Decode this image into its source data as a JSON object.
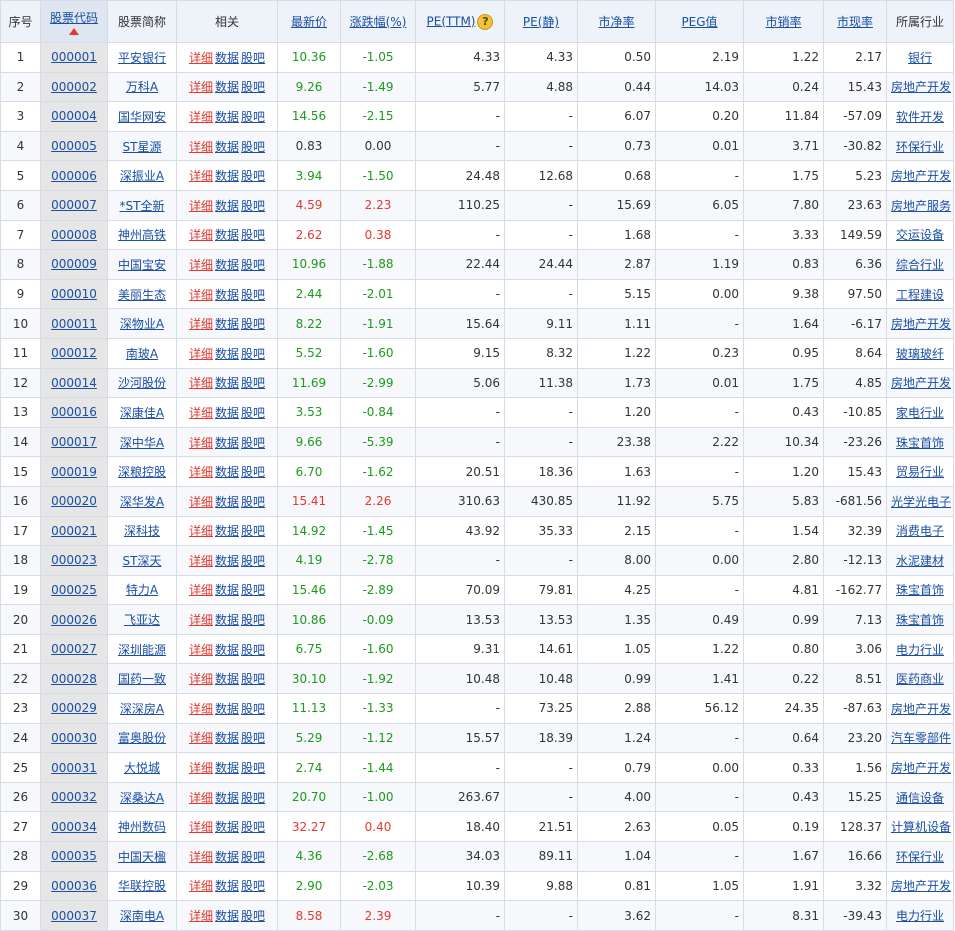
{
  "headers": {
    "idx": "序号",
    "code": "股票代码",
    "name": "股票简称",
    "related": "相关",
    "price": "最新价",
    "change": "涨跌幅(%)",
    "pe_ttm": "PE(TTM)",
    "pe_static": "PE(静)",
    "pb": "市净率",
    "peg": "PEG值",
    "ps": "市销率",
    "pcf": "市现率",
    "industry": "所属行业"
  },
  "related_links": {
    "detail": "详细",
    "data": "数据",
    "bar": "股吧"
  },
  "help_icon_glyph": "?",
  "colors": {
    "up": "#e4392f",
    "down": "#1c9a1c",
    "link": "#1a4fa3"
  },
  "rows": [
    {
      "idx": "1",
      "code": "000001",
      "name": "平安银行",
      "price": "10.36",
      "change": "-1.05",
      "pe_ttm": "4.33",
      "pe_static": "4.33",
      "pb": "0.50",
      "peg": "2.19",
      "ps": "1.22",
      "pcf": "2.17",
      "industry": "银行",
      "dir": "down"
    },
    {
      "idx": "2",
      "code": "000002",
      "name": "万科A",
      "price": "9.26",
      "change": "-1.49",
      "pe_ttm": "5.77",
      "pe_static": "4.88",
      "pb": "0.44",
      "peg": "14.03",
      "ps": "0.24",
      "pcf": "15.43",
      "industry": "房地产开发",
      "dir": "down"
    },
    {
      "idx": "3",
      "code": "000004",
      "name": "国华网安",
      "price": "14.56",
      "change": "-2.15",
      "pe_ttm": "-",
      "pe_static": "-",
      "pb": "6.07",
      "peg": "0.20",
      "ps": "11.84",
      "pcf": "-57.09",
      "industry": "软件开发",
      "dir": "down"
    },
    {
      "idx": "4",
      "code": "000005",
      "name": "ST星源",
      "price": "0.83",
      "change": "0.00",
      "pe_ttm": "-",
      "pe_static": "-",
      "pb": "0.73",
      "peg": "0.01",
      "ps": "3.71",
      "pcf": "-30.82",
      "industry": "环保行业",
      "dir": "flat"
    },
    {
      "idx": "5",
      "code": "000006",
      "name": "深振业A",
      "price": "3.94",
      "change": "-1.50",
      "pe_ttm": "24.48",
      "pe_static": "12.68",
      "pb": "0.68",
      "peg": "-",
      "ps": "1.75",
      "pcf": "5.23",
      "industry": "房地产开发",
      "dir": "down"
    },
    {
      "idx": "6",
      "code": "000007",
      "name": "*ST全新",
      "price": "4.59",
      "change": "2.23",
      "pe_ttm": "110.25",
      "pe_static": "-",
      "pb": "15.69",
      "peg": "6.05",
      "ps": "7.80",
      "pcf": "23.63",
      "industry": "房地产服务",
      "dir": "up"
    },
    {
      "idx": "7",
      "code": "000008",
      "name": "神州高铁",
      "price": "2.62",
      "change": "0.38",
      "pe_ttm": "-",
      "pe_static": "-",
      "pb": "1.68",
      "peg": "-",
      "ps": "3.33",
      "pcf": "149.59",
      "industry": "交运设备",
      "dir": "up"
    },
    {
      "idx": "8",
      "code": "000009",
      "name": "中国宝安",
      "price": "10.96",
      "change": "-1.88",
      "pe_ttm": "22.44",
      "pe_static": "24.44",
      "pb": "2.87",
      "peg": "1.19",
      "ps": "0.83",
      "pcf": "6.36",
      "industry": "综合行业",
      "dir": "down"
    },
    {
      "idx": "9",
      "code": "000010",
      "name": "美丽生态",
      "price": "2.44",
      "change": "-2.01",
      "pe_ttm": "-",
      "pe_static": "-",
      "pb": "5.15",
      "peg": "0.00",
      "ps": "9.38",
      "pcf": "97.50",
      "industry": "工程建设",
      "dir": "down"
    },
    {
      "idx": "10",
      "code": "000011",
      "name": "深物业A",
      "price": "8.22",
      "change": "-1.91",
      "pe_ttm": "15.64",
      "pe_static": "9.11",
      "pb": "1.11",
      "peg": "-",
      "ps": "1.64",
      "pcf": "-6.17",
      "industry": "房地产开发",
      "dir": "down"
    },
    {
      "idx": "11",
      "code": "000012",
      "name": "南玻A",
      "price": "5.52",
      "change": "-1.60",
      "pe_ttm": "9.15",
      "pe_static": "8.32",
      "pb": "1.22",
      "peg": "0.23",
      "ps": "0.95",
      "pcf": "8.64",
      "industry": "玻璃玻纤",
      "dir": "down"
    },
    {
      "idx": "12",
      "code": "000014",
      "name": "沙河股份",
      "price": "11.69",
      "change": "-2.99",
      "pe_ttm": "5.06",
      "pe_static": "11.38",
      "pb": "1.73",
      "peg": "0.01",
      "ps": "1.75",
      "pcf": "4.85",
      "industry": "房地产开发",
      "dir": "down"
    },
    {
      "idx": "13",
      "code": "000016",
      "name": "深康佳A",
      "price": "3.53",
      "change": "-0.84",
      "pe_ttm": "-",
      "pe_static": "-",
      "pb": "1.20",
      "peg": "-",
      "ps": "0.43",
      "pcf": "-10.85",
      "industry": "家电行业",
      "dir": "down"
    },
    {
      "idx": "14",
      "code": "000017",
      "name": "深中华A",
      "price": "9.66",
      "change": "-5.39",
      "pe_ttm": "-",
      "pe_static": "-",
      "pb": "23.38",
      "peg": "2.22",
      "ps": "10.34",
      "pcf": "-23.26",
      "industry": "珠宝首饰",
      "dir": "down"
    },
    {
      "idx": "15",
      "code": "000019",
      "name": "深粮控股",
      "price": "6.70",
      "change": "-1.62",
      "pe_ttm": "20.51",
      "pe_static": "18.36",
      "pb": "1.63",
      "peg": "-",
      "ps": "1.20",
      "pcf": "15.43",
      "industry": "贸易行业",
      "dir": "down"
    },
    {
      "idx": "16",
      "code": "000020",
      "name": "深华发A",
      "price": "15.41",
      "change": "2.26",
      "pe_ttm": "310.63",
      "pe_static": "430.85",
      "pb": "11.92",
      "peg": "5.75",
      "ps": "5.83",
      "pcf": "-681.56",
      "industry": "光学光电子",
      "dir": "up"
    },
    {
      "idx": "17",
      "code": "000021",
      "name": "深科技",
      "price": "14.92",
      "change": "-1.45",
      "pe_ttm": "43.92",
      "pe_static": "35.33",
      "pb": "2.15",
      "peg": "-",
      "ps": "1.54",
      "pcf": "32.39",
      "industry": "消费电子",
      "dir": "down"
    },
    {
      "idx": "18",
      "code": "000023",
      "name": "ST深天",
      "price": "4.19",
      "change": "-2.78",
      "pe_ttm": "-",
      "pe_static": "-",
      "pb": "8.00",
      "peg": "0.00",
      "ps": "2.80",
      "pcf": "-12.13",
      "industry": "水泥建材",
      "dir": "down"
    },
    {
      "idx": "19",
      "code": "000025",
      "name": "特力A",
      "price": "15.46",
      "change": "-2.89",
      "pe_ttm": "70.09",
      "pe_static": "79.81",
      "pb": "4.25",
      "peg": "-",
      "ps": "4.81",
      "pcf": "-162.77",
      "industry": "珠宝首饰",
      "dir": "down"
    },
    {
      "idx": "20",
      "code": "000026",
      "name": "飞亚达",
      "price": "10.86",
      "change": "-0.09",
      "pe_ttm": "13.53",
      "pe_static": "13.53",
      "pb": "1.35",
      "peg": "0.49",
      "ps": "0.99",
      "pcf": "7.13",
      "industry": "珠宝首饰",
      "dir": "down"
    },
    {
      "idx": "21",
      "code": "000027",
      "name": "深圳能源",
      "price": "6.75",
      "change": "-1.60",
      "pe_ttm": "9.31",
      "pe_static": "14.61",
      "pb": "1.05",
      "peg": "1.22",
      "ps": "0.80",
      "pcf": "3.06",
      "industry": "电力行业",
      "dir": "down"
    },
    {
      "idx": "22",
      "code": "000028",
      "name": "国药一致",
      "price": "30.10",
      "change": "-1.92",
      "pe_ttm": "10.48",
      "pe_static": "10.48",
      "pb": "0.99",
      "peg": "1.41",
      "ps": "0.22",
      "pcf": "8.51",
      "industry": "医药商业",
      "dir": "down"
    },
    {
      "idx": "23",
      "code": "000029",
      "name": "深深房A",
      "price": "11.13",
      "change": "-1.33",
      "pe_ttm": "-",
      "pe_static": "73.25",
      "pb": "2.88",
      "peg": "56.12",
      "ps": "24.35",
      "pcf": "-87.63",
      "industry": "房地产开发",
      "dir": "down"
    },
    {
      "idx": "24",
      "code": "000030",
      "name": "富奥股份",
      "price": "5.29",
      "change": "-1.12",
      "pe_ttm": "15.57",
      "pe_static": "18.39",
      "pb": "1.24",
      "peg": "-",
      "ps": "0.64",
      "pcf": "23.20",
      "industry": "汽车零部件",
      "dir": "down"
    },
    {
      "idx": "25",
      "code": "000031",
      "name": "大悦城",
      "price": "2.74",
      "change": "-1.44",
      "pe_ttm": "-",
      "pe_static": "-",
      "pb": "0.79",
      "peg": "0.00",
      "ps": "0.33",
      "pcf": "1.56",
      "industry": "房地产开发",
      "dir": "down"
    },
    {
      "idx": "26",
      "code": "000032",
      "name": "深桑达A",
      "price": "20.70",
      "change": "-1.00",
      "pe_ttm": "263.67",
      "pe_static": "-",
      "pb": "4.00",
      "peg": "-",
      "ps": "0.43",
      "pcf": "15.25",
      "industry": "通信设备",
      "dir": "down"
    },
    {
      "idx": "27",
      "code": "000034",
      "name": "神州数码",
      "price": "32.27",
      "change": "0.40",
      "pe_ttm": "18.40",
      "pe_static": "21.51",
      "pb": "2.63",
      "peg": "0.05",
      "ps": "0.19",
      "pcf": "128.37",
      "industry": "计算机设备",
      "dir": "up"
    },
    {
      "idx": "28",
      "code": "000035",
      "name": "中国天楹",
      "price": "4.36",
      "change": "-2.68",
      "pe_ttm": "34.03",
      "pe_static": "89.11",
      "pb": "1.04",
      "peg": "-",
      "ps": "1.67",
      "pcf": "16.66",
      "industry": "环保行业",
      "dir": "down"
    },
    {
      "idx": "29",
      "code": "000036",
      "name": "华联控股",
      "price": "2.90",
      "change": "-2.03",
      "pe_ttm": "10.39",
      "pe_static": "9.88",
      "pb": "0.81",
      "peg": "1.05",
      "ps": "1.91",
      "pcf": "3.32",
      "industry": "房地产开发",
      "dir": "down"
    },
    {
      "idx": "30",
      "code": "000037",
      "name": "深南电A",
      "price": "8.58",
      "change": "2.39",
      "pe_ttm": "-",
      "pe_static": "-",
      "pb": "3.62",
      "peg": "-",
      "ps": "8.31",
      "pcf": "-39.43",
      "industry": "电力行业",
      "dir": "up"
    }
  ]
}
